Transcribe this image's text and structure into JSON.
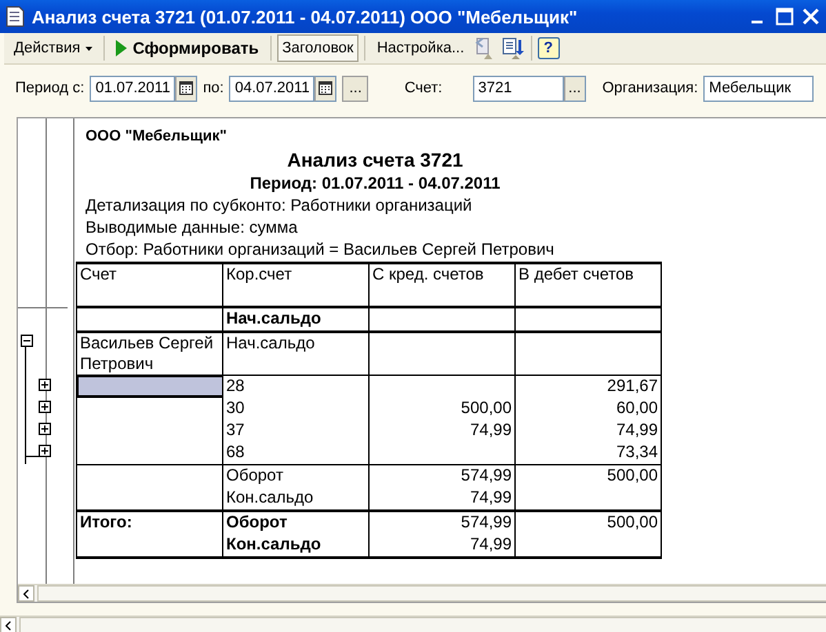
{
  "window": {
    "title": "Анализ счета 3721 (01.07.2011 - 04.07.2011) ООО \"Мебельщик\""
  },
  "toolbar": [
    {
      "kind": "menu",
      "label": "Действия"
    },
    {
      "kind": "run",
      "label": "Сформировать"
    },
    {
      "kind": "toggle",
      "label": "Заголовок",
      "on": true
    },
    {
      "kind": "text",
      "label": "Настройка..."
    },
    {
      "kind": "restore"
    },
    {
      "kind": "save"
    },
    {
      "kind": "help",
      "label": "?"
    }
  ],
  "filters": {
    "period_label": "Период с:",
    "period_from": "01.07.2011",
    "to_label": "по:",
    "period_to": "04.07.2011",
    "period_button": "...",
    "account_label": "Счет:",
    "account": "3721",
    "account_button": "...",
    "org_label": "Организация:",
    "organization": "Мебельщик"
  },
  "report": {
    "organization": "ООО \"Мебельщик\"",
    "title": "Анализ счета 3721",
    "period": "Период: 01.07.2011 - 04.07.2011",
    "lines": [
      "Детализация по  субконто: Работники организаций",
      "Выводимые данные: сумма",
      "Отбор: Работники организаций = Васильев Сергей Петрович"
    ],
    "columns": [
      "Счет",
      "Кор.счет",
      "С кред. счетов",
      "В дебет счетов"
    ],
    "groups": [
      {
        "kind": "total",
        "rows": [
          {
            "bold": true,
            "cells": [
              "",
              "Нач.сальдо",
              "",
              ""
            ]
          }
        ]
      },
      {
        "kind": "detail",
        "rows": [
          {
            "expanded": true,
            "cells": [
              "Васильев Сергей Петрович",
              "Нач.сальдо",
              "",
              ""
            ]
          }
        ]
      },
      {
        "kind": "detail",
        "rows": [
          {
            "expanded": false,
            "selected": true,
            "cells": [
              "",
              "28",
              "",
              "291,67"
            ]
          },
          {
            "expanded": false,
            "selected": false,
            "cells": [
              "",
              "30",
              "500,00",
              "60,00"
            ]
          },
          {
            "expanded": false,
            "selected": false,
            "cells": [
              "",
              "37",
              "74,99",
              "74,99"
            ]
          },
          {
            "expanded": false,
            "selected": false,
            "cells": [
              "",
              "68",
              "",
              "73,34"
            ]
          }
        ]
      },
      {
        "kind": "detail",
        "rows": [
          {
            "cells": [
              "",
              "Оборот",
              "574,99",
              "500,00"
            ]
          },
          {
            "cells": [
              "",
              "Кон.сальдо",
              "74,99",
              ""
            ]
          }
        ]
      },
      {
        "kind": "total",
        "rows": [
          {
            "bold": true,
            "cells": [
              "Итого:",
              "Оборот",
              "574,99",
              "500,00"
            ]
          },
          {
            "bold": true,
            "cells": [
              "",
              "Кон.сальдо",
              "74,99",
              ""
            ]
          }
        ]
      }
    ]
  }
}
